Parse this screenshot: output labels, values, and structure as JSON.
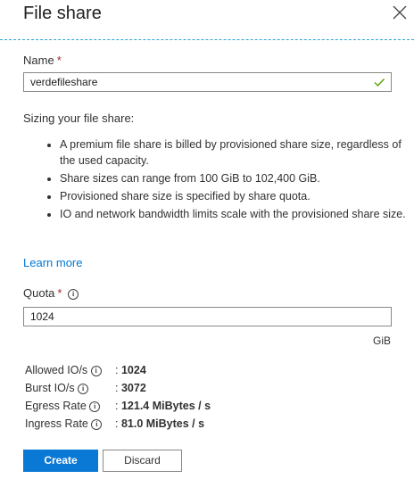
{
  "panel": {
    "title": "File share"
  },
  "name_field": {
    "label": "Name",
    "required_mark": "*",
    "value": "verdefileshare"
  },
  "sizing": {
    "heading": "Sizing your file share:",
    "bullets": [
      "A premium file share is billed by provisioned share size, regardless of the used capacity.",
      "Share sizes can range from 100 GiB to 102,400 GiB.",
      "Provisioned share size is specified by share quota.",
      "IO and network bandwidth limits scale with the provisioned share size."
    ]
  },
  "learn_more": "Learn more",
  "quota": {
    "label": "Quota",
    "required_mark": "*",
    "value": "1024",
    "unit": "GiB"
  },
  "stats": [
    {
      "label": "Allowed IO/s",
      "value": "1024"
    },
    {
      "label": "Burst IO/s",
      "value": "3072"
    },
    {
      "label": "Egress Rate",
      "value": "121.4 MiBytes / s"
    },
    {
      "label": "Ingress Rate",
      "value": "81.0 MiBytes / s"
    }
  ],
  "stat_separator": ":",
  "info_glyph": "i",
  "buttons": {
    "create": "Create",
    "discard": "Discard"
  },
  "colors": {
    "accent": "#0078d4",
    "primary_button": "#0a78d5",
    "required": "#a4262c",
    "divider": "#2fa3d7",
    "valid_check": "#57a300"
  },
  "icons": {
    "close": "close-icon",
    "check": "checkmark-icon",
    "info": "info-icon"
  }
}
